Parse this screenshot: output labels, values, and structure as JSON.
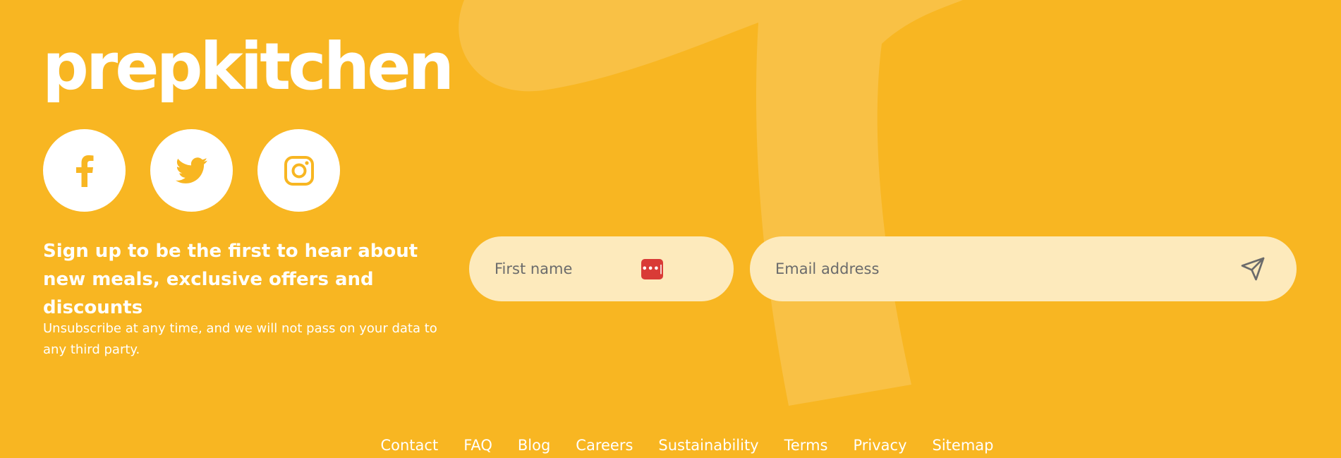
{
  "brand": {
    "logo_text": "prepkitchen",
    "background_color": "#F8B622",
    "field_color": "#FDEABC"
  },
  "social": [
    {
      "name": "facebook",
      "icon": "facebook-icon"
    },
    {
      "name": "twitter",
      "icon": "twitter-icon"
    },
    {
      "name": "instagram",
      "icon": "instagram-icon"
    }
  ],
  "signup": {
    "heading": "Sign up to be the first to hear about new meals, exclusive offers and discounts",
    "note": "Unsubscribe at any time, and we will not pass on your data to any third party.",
    "first_name_placeholder": "First name",
    "first_name_value": "",
    "email_placeholder": "Email address",
    "email_value": "",
    "password_manager_badge": "•••|",
    "submit_icon": "send-icon"
  },
  "footer_nav": {
    "contact": "Contact",
    "faq": "FAQ",
    "blog": "Blog",
    "careers": "Careers",
    "sustainability": "Sustainability",
    "terms": "Terms",
    "privacy": "Privacy",
    "sitemap": "Sitemap"
  }
}
